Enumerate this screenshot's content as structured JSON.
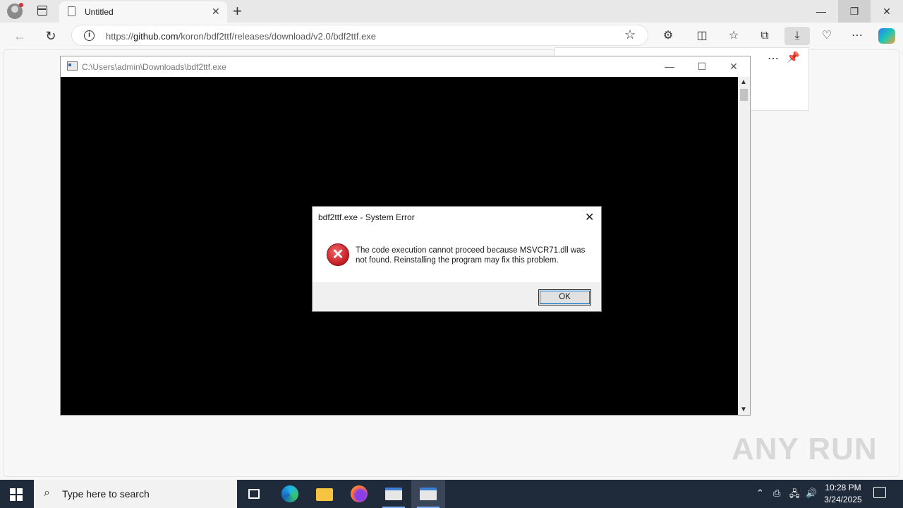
{
  "browser": {
    "tab_title": "Untitled",
    "tab_close": "✕",
    "new_tab": "+",
    "url_prefix": "https://",
    "url_host": "github.com",
    "url_path": "/koron/bdf2ttf/releases/download/v2.0/bdf2ttf.exe",
    "window_min": "—",
    "window_restore": "❐",
    "window_close": "✕"
  },
  "console": {
    "title": "C:\\Users\\admin\\Downloads\\bdf2ttf.exe",
    "min": "—",
    "max": "☐",
    "close": "✕"
  },
  "dialog": {
    "title": "bdf2ttf.exe - System Error",
    "close": "✕",
    "message": "The code execution cannot proceed because MSVCR71.dll was not found. Reinstalling the program may fix this problem.",
    "ok_label": "OK"
  },
  "watermark": "ANY RUN",
  "taskbar": {
    "search_placeholder": "Type here to search",
    "time": "10:28 PM",
    "date": "3/24/2025"
  },
  "colors": {
    "taskbar_bg": "#1f2a3b",
    "error_red": "#c21b22",
    "console_bg": "#000000"
  }
}
